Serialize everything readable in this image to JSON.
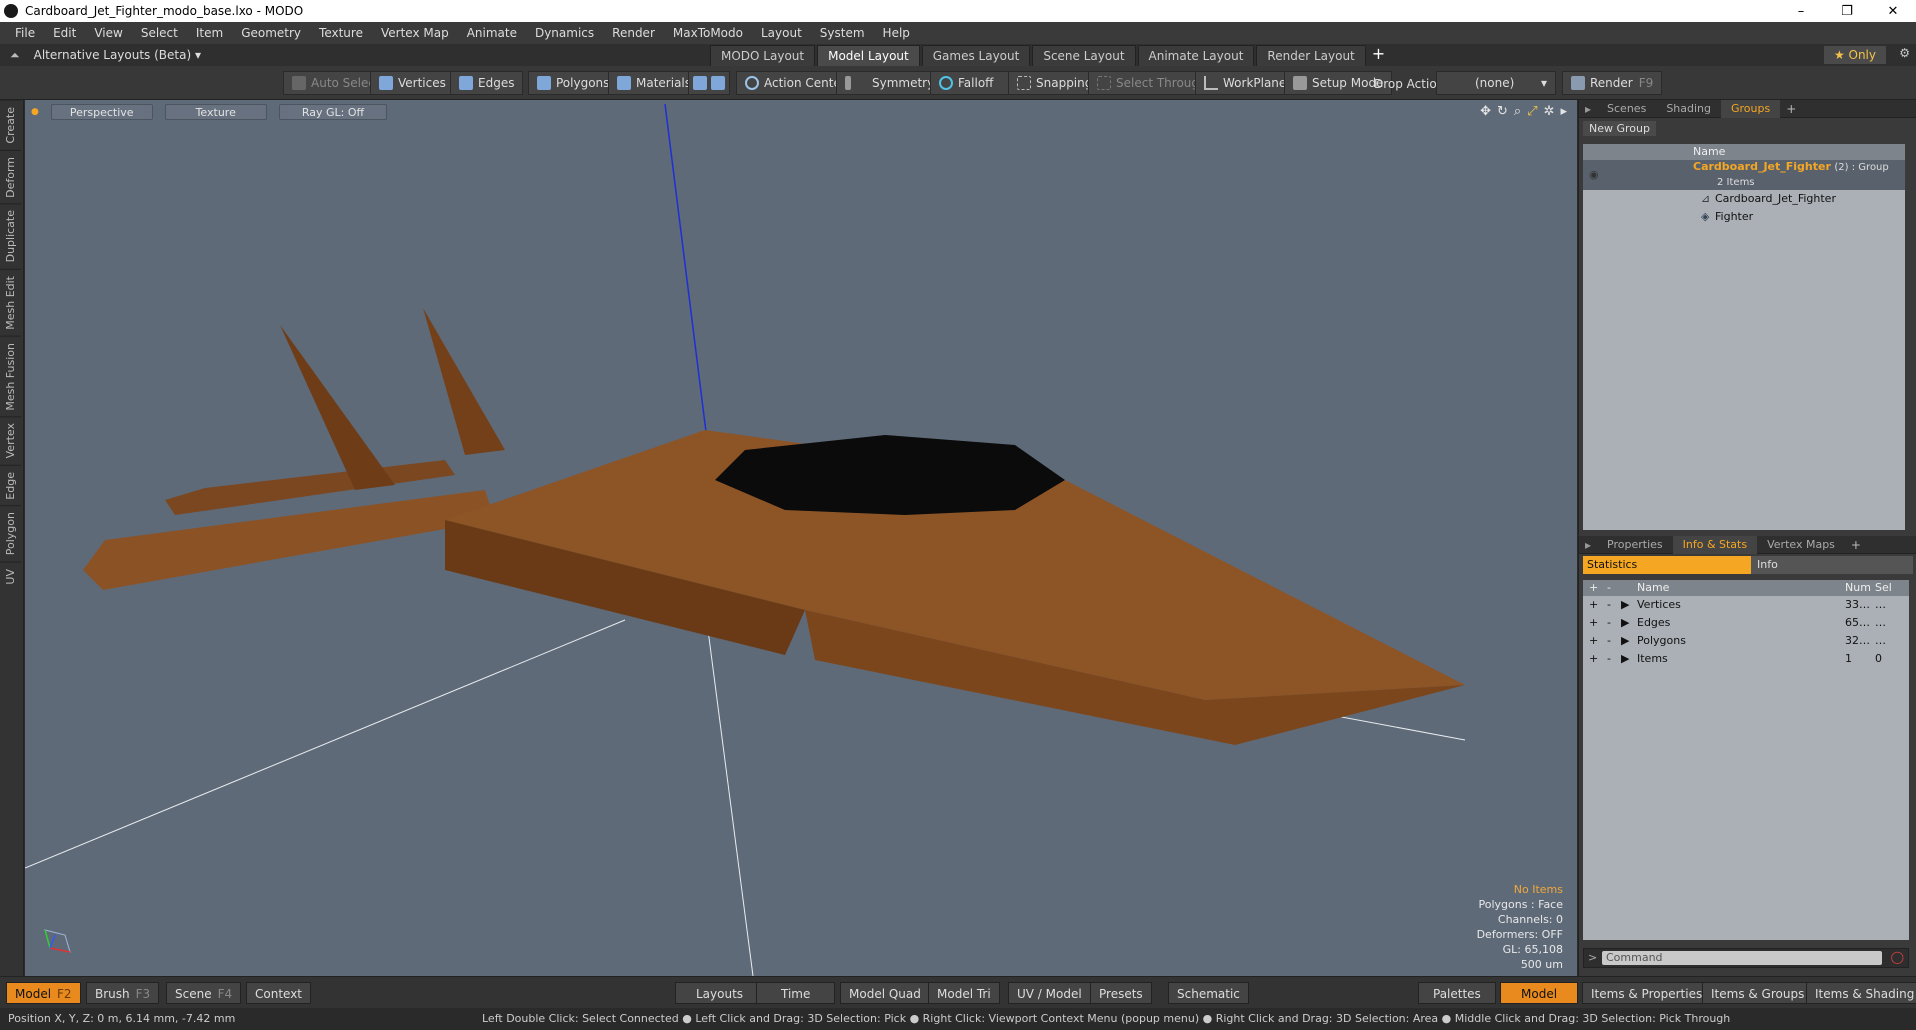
{
  "window": {
    "title": "Cardboard_Jet_Fighter_modo_base.lxo - MODO"
  },
  "menu": [
    "File",
    "Edit",
    "View",
    "Select",
    "Item",
    "Geometry",
    "Texture",
    "Vertex Map",
    "Animate",
    "Dynamics",
    "Render",
    "MaxToModo",
    "Layout",
    "System",
    "Help"
  ],
  "layoutbar": {
    "alt_layouts": "Alternative Layouts (Beta) ▾",
    "tabs": [
      "MODO Layout",
      "Model Layout",
      "Games Layout",
      "Scene Layout",
      "Animate Layout",
      "Render Layout"
    ],
    "only": "★ Only"
  },
  "toolbar": {
    "auto_select": "Auto Select",
    "vertices": "Vertices",
    "edges": "Edges",
    "polygons": "Polygons",
    "materials": "Materials",
    "action_center": "Action Center",
    "symmetry": "Symmetry",
    "falloff": "Falloff",
    "snapping": "Snapping",
    "select_through": "Select Through",
    "workplane": "WorkPlane",
    "setup_mode": "Setup Mode",
    "drop_action_label": "Drop Action",
    "drop_action_value": "(none)",
    "render": "Render",
    "render_key": "F9"
  },
  "left_tabs": [
    "Create",
    "Deform",
    "Duplicate",
    "Mesh Edit",
    "Mesh Fusion",
    "Vertex",
    "Edge",
    "Polygon",
    "UV"
  ],
  "viewport": {
    "view": "Perspective",
    "shading": "Texture",
    "raygl": "Ray GL: Off",
    "stats": {
      "items": "No Items",
      "polygons": "Polygons : Face",
      "channels": "Channels: 0",
      "deformers": "Deformers: OFF",
      "gl": "GL: 65,108",
      "scale": "500 um"
    }
  },
  "groups_panel": {
    "tabs": [
      "Scenes",
      "Shading",
      "Groups"
    ],
    "new_group": "New Group",
    "name_header": "Name",
    "group_name": "Cardboard_Jet_Fighter",
    "group_suffix": "(2) : Group",
    "group_count": "2 Items",
    "children": [
      "Cardboard_Jet_Fighter",
      "Fighter"
    ]
  },
  "props_panel": {
    "tabs": [
      "Properties",
      "Info & Stats",
      "Vertex Maps"
    ],
    "statistics": "Statistics",
    "info": "Info",
    "col_name": "Name",
    "col_num": "Num",
    "col_sel": "Sel",
    "rows": [
      {
        "name": "Vertices",
        "num": "33…",
        "sel": "…"
      },
      {
        "name": "Edges",
        "num": "65…",
        "sel": "…"
      },
      {
        "name": "Polygons",
        "num": "32…",
        "sel": "…"
      },
      {
        "name": "Items",
        "num": "1",
        "sel": "0"
      }
    ]
  },
  "command": {
    "placeholder": "Command"
  },
  "bottombar": {
    "model": "Model",
    "model_key": "F2",
    "brush": "Brush",
    "brush_key": "F3",
    "scene": "Scene",
    "scene_key": "F4",
    "context": "Context",
    "layouts": "Layouts",
    "time": "Time",
    "model_quad": "Model Quad",
    "model_tri": "Model Tri",
    "uv_model": "UV / Model",
    "presets": "Presets",
    "schematic": "Schematic",
    "palettes": "Palettes",
    "model_right": "Model",
    "items_props": "Items & Properties",
    "items_groups": "Items & Groups",
    "items_shading": "Items & Shading"
  },
  "status": {
    "position": "Position X, Y, Z:   0 m, 6.14 mm, -7.42 mm",
    "hints": "Left Double Click: Select Connected ● Left Click and Drag: 3D Selection: Pick ● Right Click: Viewport Context Menu (popup menu) ● Right Click and Drag: 3D Selection: Area ● Middle Click and Drag: 3D Selection: Pick Through"
  }
}
